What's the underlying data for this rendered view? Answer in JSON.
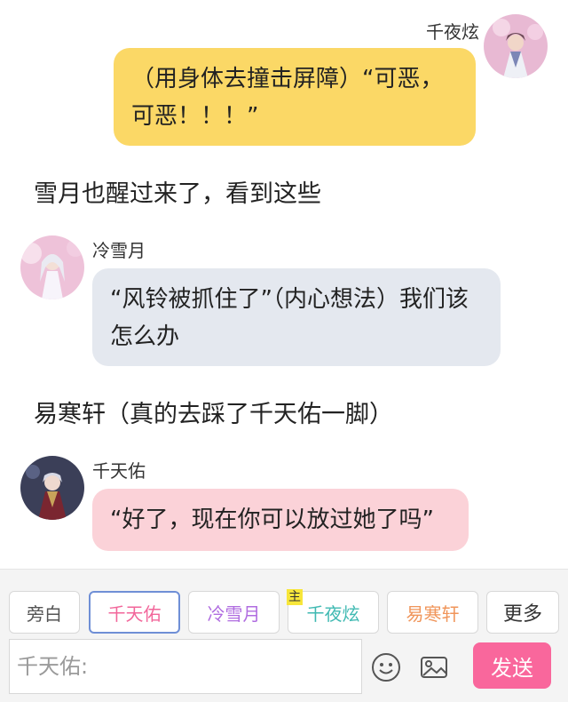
{
  "messages": [
    {
      "speaker": "千夜炫",
      "text": "（用身体去撞击屏障）“可恶，可恶！！！”",
      "bubble_color": "#fbd866"
    },
    {
      "narration": "雪月也醒过来了，看到这些"
    },
    {
      "speaker": "冷雪月",
      "text": "“风铃被抓住了”（内心想法）我们该怎么办",
      "bubble_color": "#e4e8ef"
    },
    {
      "narration": "易寒轩（真的去踩了千天佑一脚）"
    },
    {
      "speaker": "千天佑",
      "text": "“好了，现在你可以放过她了吗”",
      "bubble_color": "#fbd2d8"
    }
  ],
  "toolbar": {
    "chars": [
      {
        "label": "旁白",
        "color": "#555555"
      },
      {
        "label": "千天佑",
        "color": "#f2669a"
      },
      {
        "label": "冷雪月",
        "color": "#b06de0"
      },
      {
        "label": "千夜炫",
        "color": "#3fb9b2",
        "badge": "主"
      },
      {
        "label": "易寒轩",
        "color": "#f0955a"
      },
      {
        "label": "更多",
        "color": "#333333"
      }
    ],
    "input_placeholder": "千天佑:",
    "send_label": "发送",
    "send_color": "#f9679c"
  }
}
